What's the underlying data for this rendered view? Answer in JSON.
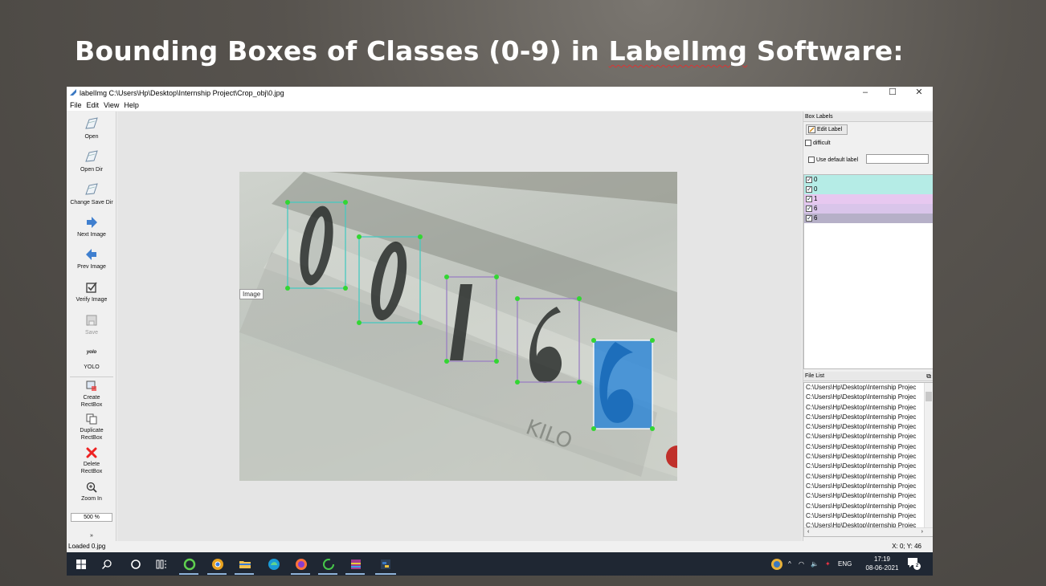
{
  "slide": {
    "title_prefix": "Bounding Boxes of Classes (0-9) in ",
    "title_app": "LabelImg",
    "title_suffix": " Software:"
  },
  "window": {
    "title": "labelImg C:\\Users\\Hp\\Desktop\\Internship Project\\Crop_obj\\0.jpg",
    "minimize": "–",
    "maximize": "☐",
    "close": "✕"
  },
  "menu": [
    "File",
    "Edit",
    "View",
    "Help"
  ],
  "toolbar": {
    "open": "Open",
    "open_dir": "Open Dir",
    "change_save_dir": "Change Save Dir",
    "next_image": "Next Image",
    "prev_image": "Prev Image",
    "verify_image": "Verify Image",
    "save": "Save",
    "yolo_icon": "yolo",
    "yolo": "YOLO",
    "create_rectbox_1": "Create",
    "create_rectbox_2": "RectBox",
    "duplicate_rectbox_1": "Duplicate",
    "duplicate_rectbox_2": "RectBox",
    "delete_rectbox_1": "Delete",
    "delete_rectbox_2": "RectBox",
    "zoom_in": "Zoom In",
    "zoom_value": "500 %",
    "more": "»"
  },
  "canvas": {
    "tooltip": "Image"
  },
  "box_labels": {
    "header": "Box Labels",
    "edit_label": "Edit Label",
    "difficult": "difficult",
    "use_default_label": "Use default label",
    "items": [
      {
        "label": "0",
        "color": "#b5ece6"
      },
      {
        "label": "0",
        "color": "#b5ece6"
      },
      {
        "label": "1",
        "color": "#e7c8f0"
      },
      {
        "label": "6",
        "color": "#d9c5ea"
      },
      {
        "label": "6",
        "color": "#b6b0c8"
      }
    ]
  },
  "file_list": {
    "header": "File List",
    "items": [
      "C:\\Users\\Hp\\Desktop\\Internship Projec",
      "C:\\Users\\Hp\\Desktop\\Internship Projec",
      "C:\\Users\\Hp\\Desktop\\Internship Projec",
      "C:\\Users\\Hp\\Desktop\\Internship Projec",
      "C:\\Users\\Hp\\Desktop\\Internship Projec",
      "C:\\Users\\Hp\\Desktop\\Internship Projec",
      "C:\\Users\\Hp\\Desktop\\Internship Projec",
      "C:\\Users\\Hp\\Desktop\\Internship Projec",
      "C:\\Users\\Hp\\Desktop\\Internship Projec",
      "C:\\Users\\Hp\\Desktop\\Internship Projec",
      "C:\\Users\\Hp\\Desktop\\Internship Projec",
      "C:\\Users\\Hp\\Desktop\\Internship Projec",
      "C:\\Users\\Hp\\Desktop\\Internship Projec",
      "C:\\Users\\Hp\\Desktop\\Internship Projec",
      "C:\\Users\\Hp\\Desktop\\Internship Projec"
    ]
  },
  "status": {
    "left": "Loaded 0.jpg",
    "right": "X: 0; Y: 46"
  },
  "taskbar": {
    "lang": "ENG",
    "time": "17:19",
    "date": "08-06-2021",
    "notifications": "2"
  },
  "colors": {
    "box_cyan": "#47c9c0",
    "box_purple": "#9a7fc2",
    "box_selected": "#1e7fd8",
    "handle": "#33d633"
  }
}
